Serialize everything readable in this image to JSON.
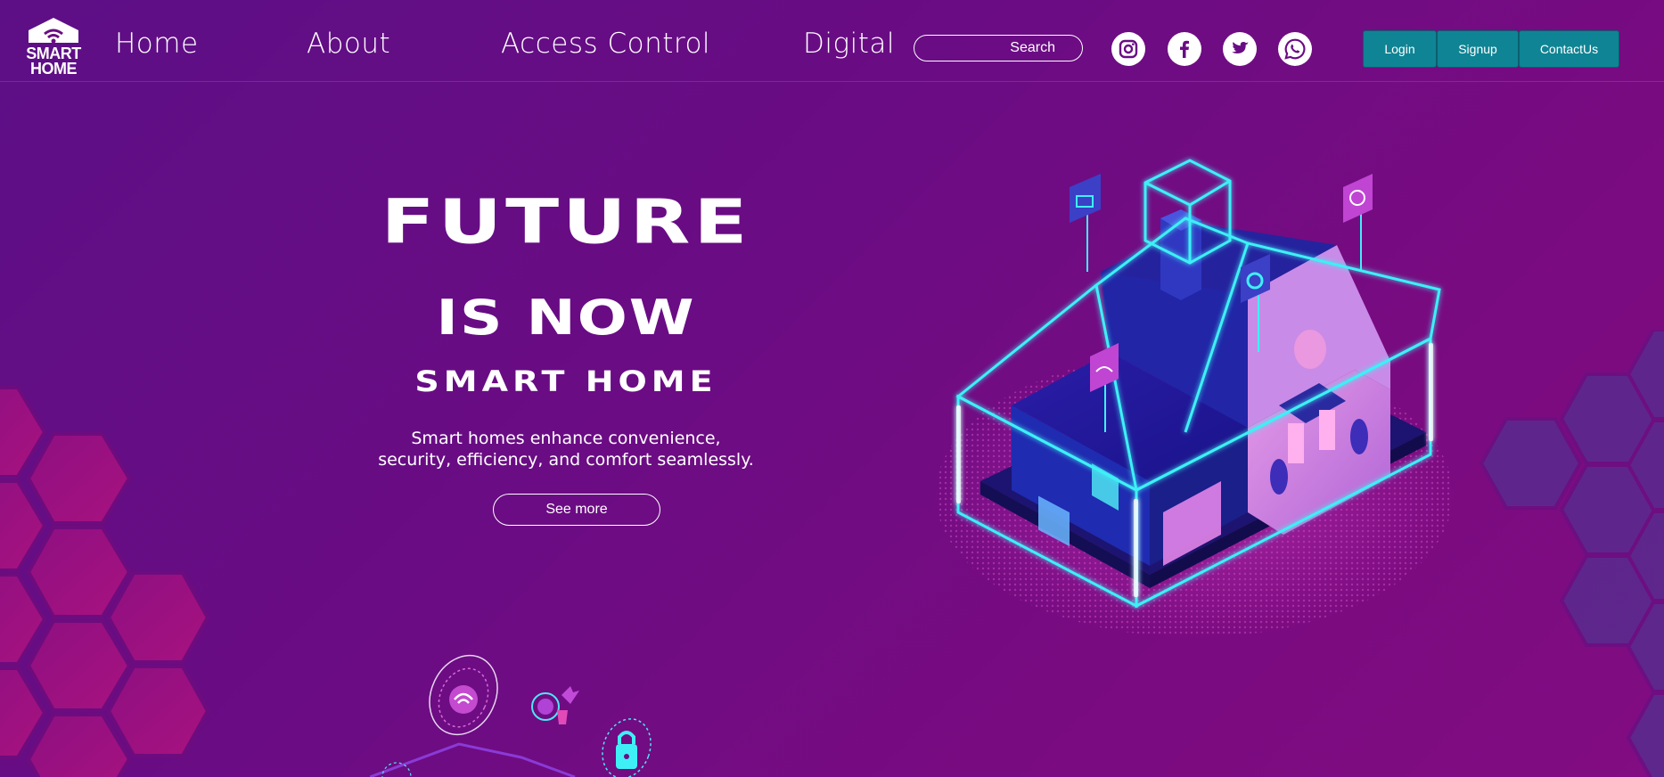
{
  "logo": {
    "line1": "SMART",
    "line2": "HOME"
  },
  "nav": {
    "home": "Home",
    "about": "About",
    "access_control": "Access Control",
    "digital": "Digital"
  },
  "search": {
    "placeholder": "Search"
  },
  "social": [
    "instagram-icon",
    "facebook-icon",
    "twitter-icon",
    "whatsapp-icon"
  ],
  "auth": {
    "login": "Login",
    "signup": "Signup",
    "contact": "ContactUs"
  },
  "hero": {
    "line1": "FUTURE",
    "line2": "IS NOW",
    "line3": "SMART HOME",
    "desc1": "Smart homes enhance convenience,",
    "desc2": "security, efficiency, and comfort seamlessly.",
    "cta": "See more"
  },
  "colors": {
    "accent": "#0f8494",
    "background": "#6a0c84",
    "neon": "#3ef0f6",
    "hex": "#a8127f"
  }
}
